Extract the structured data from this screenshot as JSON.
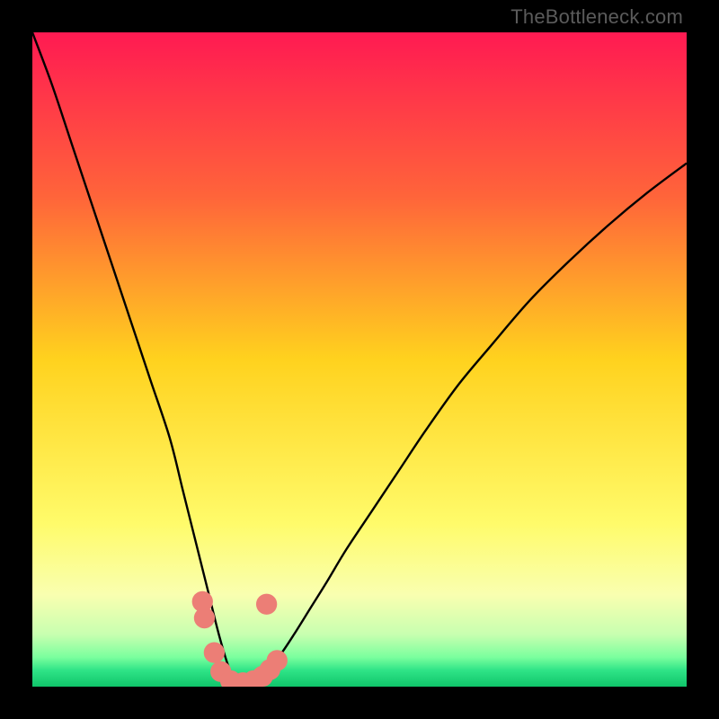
{
  "watermark": {
    "text": "TheBottleneck.com"
  },
  "chart_data": {
    "type": "line",
    "title": "",
    "xlabel": "",
    "ylabel": "",
    "xlim": [
      0,
      100
    ],
    "ylim": [
      0,
      100
    ],
    "gradient_stops": [
      {
        "offset": 0,
        "color": "#ff1a52"
      },
      {
        "offset": 0.25,
        "color": "#ff643a"
      },
      {
        "offset": 0.5,
        "color": "#ffd21e"
      },
      {
        "offset": 0.75,
        "color": "#fffb6a"
      },
      {
        "offset": 0.86,
        "color": "#f9ffb0"
      },
      {
        "offset": 0.92,
        "color": "#c8ffb0"
      },
      {
        "offset": 0.955,
        "color": "#7bff9e"
      },
      {
        "offset": 0.975,
        "color": "#2fe487"
      },
      {
        "offset": 1.0,
        "color": "#10c56a"
      }
    ],
    "series": [
      {
        "name": "bottleneck-curve",
        "x": [
          0,
          3,
          6,
          9,
          12,
          15,
          18,
          21,
          23,
          25,
          27,
          28.5,
          30,
          31,
          32,
          33,
          34,
          36,
          38,
          40,
          42.5,
          45,
          48,
          52,
          56,
          60,
          65,
          70,
          76,
          82,
          88,
          94,
          100
        ],
        "y": [
          100,
          92,
          83,
          74,
          65,
          56,
          47,
          38,
          30,
          22,
          14,
          8,
          3,
          1,
          0.5,
          0.6,
          1,
          2.5,
          5,
          8,
          12,
          16,
          21,
          27,
          33,
          39,
          46,
          52,
          59,
          65,
          70.5,
          75.5,
          80
        ]
      }
    ],
    "markers": {
      "name": "bottleneck-markers",
      "color": "#ec7e76",
      "radius_pct": 1.6,
      "points": [
        {
          "x": 26.0,
          "y": 13.0
        },
        {
          "x": 26.3,
          "y": 10.5
        },
        {
          "x": 27.8,
          "y": 5.2
        },
        {
          "x": 28.8,
          "y": 2.3
        },
        {
          "x": 30.3,
          "y": 0.9
        },
        {
          "x": 32.2,
          "y": 0.6
        },
        {
          "x": 33.8,
          "y": 0.9
        },
        {
          "x": 35.2,
          "y": 1.6
        },
        {
          "x": 36.3,
          "y": 2.6
        },
        {
          "x": 37.4,
          "y": 4.0
        },
        {
          "x": 35.8,
          "y": 12.6
        }
      ]
    }
  }
}
